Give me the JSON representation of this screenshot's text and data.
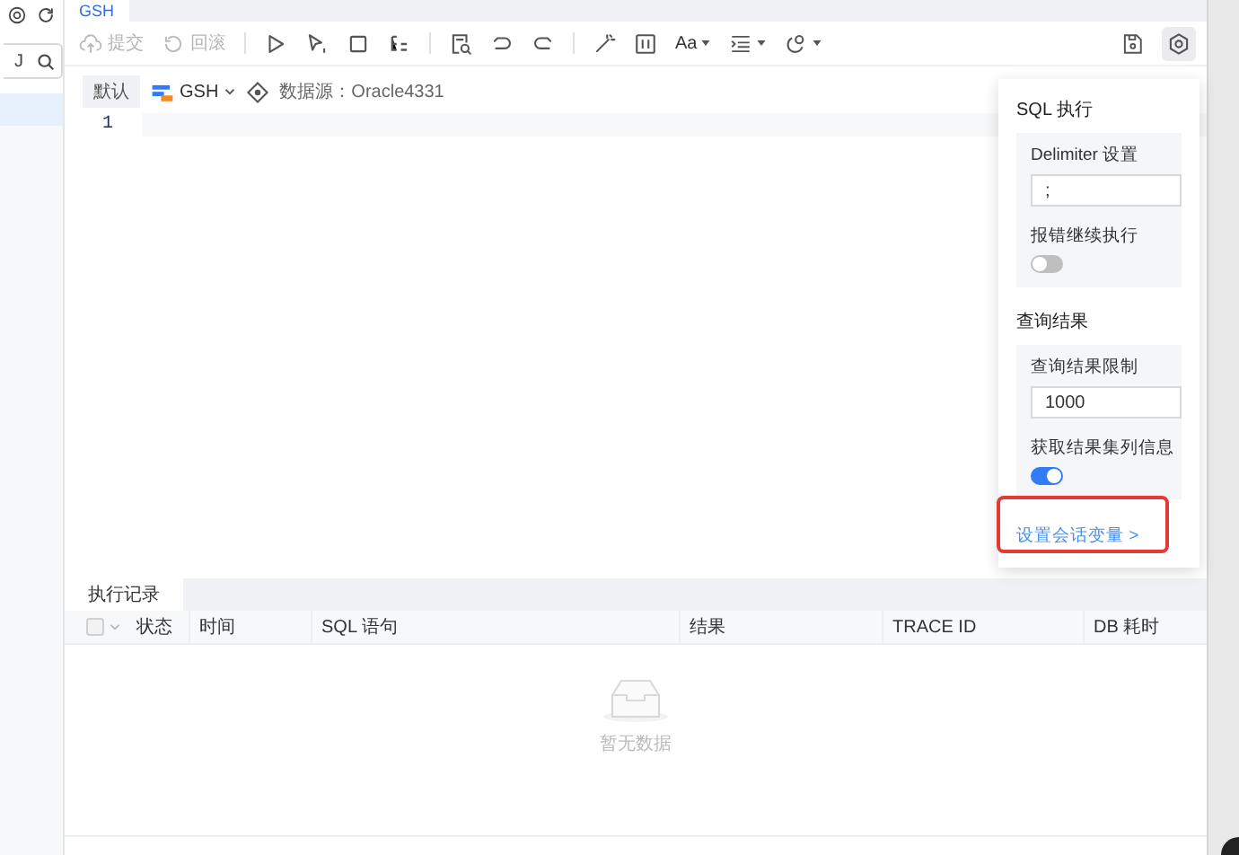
{
  "sidebar": {
    "search": {
      "value": "J"
    },
    "rows": [
      {
        "selected": true
      }
    ]
  },
  "tabs": [
    {
      "label": "GSH",
      "selected": true
    }
  ],
  "toolbar": {
    "actions": [
      {
        "label": "提交",
        "disabled": true
      },
      {
        "label": "回滚",
        "disabled": true
      }
    ],
    "font_menu": "Aa"
  },
  "context": {
    "schema_badge": "默认",
    "database": "GSH",
    "datasource": "数据源：Oracle4331"
  },
  "editor": {
    "line_numbers": [
      "1"
    ]
  },
  "settings_panel": {
    "sections": [
      {
        "title": "SQL 执行",
        "fields": [
          {
            "kind": "input",
            "label": "Delimiter 设置",
            "value": ";"
          },
          {
            "kind": "toggle",
            "label": "报错继续执行",
            "on": false
          }
        ]
      },
      {
        "title": "查询结果",
        "fields": [
          {
            "kind": "input",
            "label": "查询结果限制",
            "value": "1000"
          },
          {
            "kind": "toggle",
            "label": "获取结果集列信息",
            "on": true
          }
        ]
      }
    ],
    "link": "设置会话变量 >",
    "link_highlighted": true
  },
  "bottom_panel": {
    "tabs": [
      {
        "label": "执行记录",
        "selected": true
      }
    ],
    "table": {
      "select_all_checked": false,
      "columns": [
        "状态",
        "时间",
        "SQL 语句",
        "结果",
        "TRACE ID",
        "DB 耗时"
      ]
    },
    "empty_text": "暂无数据"
  }
}
